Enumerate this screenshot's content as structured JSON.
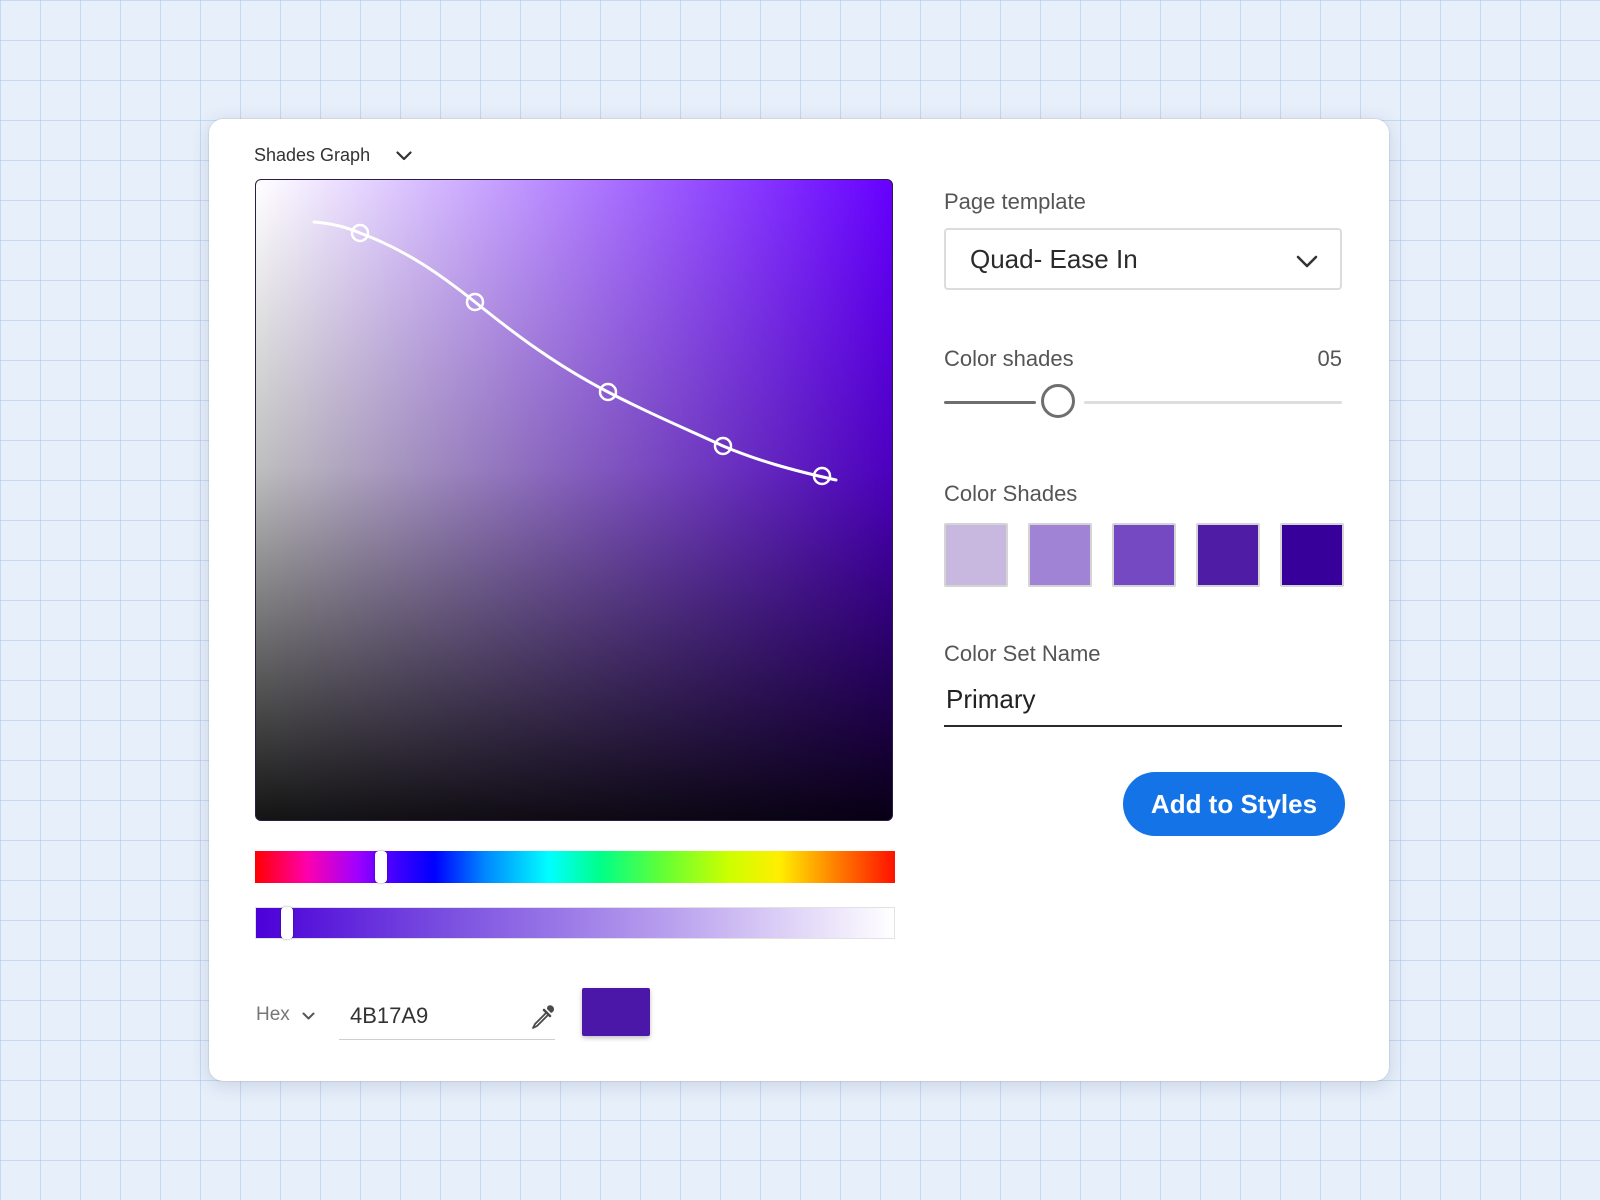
{
  "graph": {
    "mode_label": "Shades Graph"
  },
  "page_template": {
    "label": "Page template",
    "selected": "Quad- Ease In"
  },
  "color_shades_count": {
    "label": "Color shades",
    "value": "05",
    "fraction": 0.3
  },
  "color_shades": {
    "label": "Color Shades",
    "swatches": [
      "#c8b8e0",
      "#a183d6",
      "#7449c2",
      "#4f1ca6",
      "#37009a"
    ]
  },
  "color_set_name": {
    "label": "Color Set Name",
    "value": "Primary"
  },
  "add_button": {
    "label": "Add to Styles"
  },
  "color_input": {
    "mode": "Hex",
    "value": "4B17A9",
    "preview_color": "#4B17A9"
  },
  "colors": {
    "accent": "#1473e6"
  }
}
